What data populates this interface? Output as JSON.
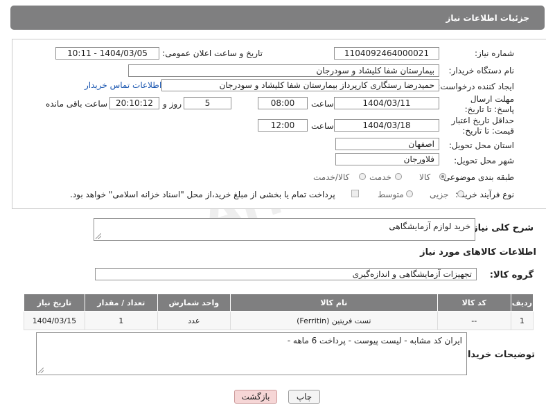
{
  "header": {
    "title": "جزئیات اطلاعات نیاز"
  },
  "labels": {
    "need_number": "شماره نیاز:",
    "announce_datetime": "تاریخ و ساعت اعلان عمومی:",
    "buyer_org": "نام دستگاه خریدار:",
    "requester": "ایجاد کننده درخواست:",
    "reply_deadline": "مهلت ارسال پاسخ: تا تاریخ:",
    "time_word": "ساعت",
    "day_and": "روز و",
    "remaining": "ساعت باقی مانده",
    "price_validity": "حداقل تاریخ اعتبار قیمت: تا تاریخ:",
    "province": "استان محل تحویل:",
    "city": "شهر محل تحویل:",
    "category": "طبقه بندی موضوعی:",
    "process_type": "نوع فرآیند خرید :",
    "need_description": "شرح کلی نیاز:",
    "goods_info": "اطلاعات کالاهای مورد نیاز",
    "goods_group": "گروه کالا:",
    "buyer_notes": "توضیحات خریدار:"
  },
  "values": {
    "need_number": "1104092464000021",
    "announce_datetime": "1404/03/05 - 10:11",
    "buyer_org": "بیمارستان شفا کلیشاد و سودرجان",
    "requester": "حمیدرضا رستگاری کارپرداز بیمارستان شفا کلیشاد و سودرجان",
    "contact_link": "اطلاعات تماس خریدار",
    "reply_date": "1404/03/11",
    "reply_time": "08:00",
    "reply_days": "5",
    "reply_remaining": "20:10:12",
    "price_date": "1404/03/18",
    "price_time": "12:00",
    "province": "اصفهان",
    "city": "فلاورجان",
    "need_description": "خرید لوازم آزمایشگاهی",
    "goods_group": "تجهیزات آزمایشگاهی و اندازه‌گیری",
    "buyer_notes": "ایران کد مشابه - لیست پیوست - پرداخت 6 ماهه -"
  },
  "category_options": [
    "کالا",
    "خدمت",
    "کالا/خدمت"
  ],
  "category_selected": "کالا",
  "process_options": [
    "جزیی",
    "متوسط"
  ],
  "process_note": "پرداخت تمام یا بخشی از مبلغ خرید،از محل \"اسناد خزانه اسلامی\" خواهد بود.",
  "table": {
    "headers": [
      "ردیف",
      "کد کالا",
      "نام کالا",
      "واحد شمارش",
      "تعداد / مقدار",
      "تاریخ نیاز"
    ],
    "rows": [
      [
        "1",
        "--",
        "تست فریتین (Ferritin)",
        "عدد",
        "1",
        "1404/03/15"
      ]
    ]
  },
  "buttons": {
    "print": "چاپ",
    "back": "بازگشت"
  },
  "watermark": "AriaTender.net"
}
